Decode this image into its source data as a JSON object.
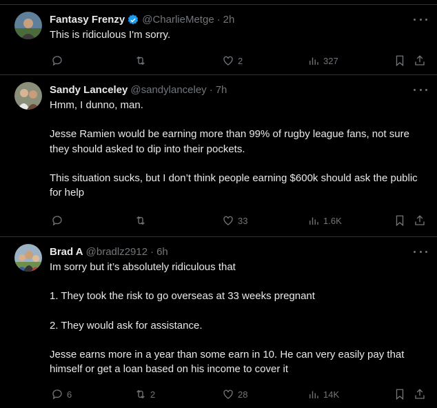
{
  "tweets": [
    {
      "name": "Fantasy Frenzy",
      "handle": "@CharlieMetge",
      "separator": "·",
      "time": "2h",
      "verified": true,
      "paragraphs": [
        "This is ridiculous I'm sorry."
      ],
      "replies": "",
      "retweets": "",
      "likes": "2",
      "views": "327"
    },
    {
      "name": "Sandy Lanceley",
      "handle": "@sandylanceley",
      "separator": "·",
      "time": "7h",
      "verified": false,
      "paragraphs": [
        "Hmm, I dunno, man.",
        "Jesse Ramien would be earning more than 99% of rugby league fans, not sure they should asked to dip into their pockets.",
        "This situation sucks, but I don’t think people earning $600k should ask the public for help"
      ],
      "replies": "",
      "retweets": "",
      "likes": "33",
      "views": "1.6K"
    },
    {
      "name": "Brad A",
      "handle": "@bradlz2912",
      "separator": "·",
      "time": "6h",
      "verified": false,
      "paragraphs": [
        "Im sorry but it’s absolutely ridiculous that",
        "1. They took the risk to go overseas at 33 weeks pregnant",
        "2. They would ask for assistance.",
        "Jesse earns more in a year than some earn in 10. He can very easily pay that himself or get a loan based on his income to cover it"
      ],
      "replies": "6",
      "retweets": "2",
      "likes": "28",
      "views": "14K"
    }
  ],
  "colors": {
    "background": "#000000",
    "text": "#e7e9ea",
    "muted": "#71767b",
    "divider": "#2f3336",
    "verified": "#1d9bf0"
  },
  "icons": [
    "reply-icon",
    "retweet-icon",
    "like-icon",
    "views-icon",
    "bookmark-icon",
    "share-icon",
    "more-icon",
    "verified-badge-icon"
  ]
}
